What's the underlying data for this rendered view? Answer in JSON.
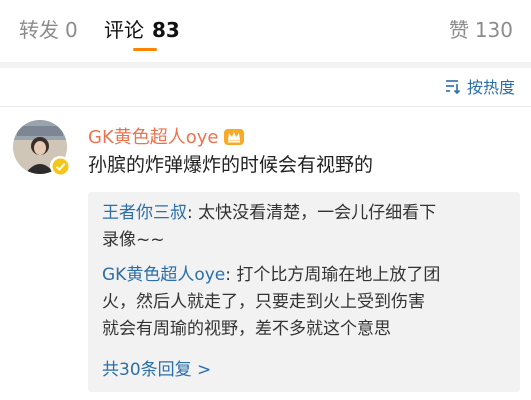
{
  "tabs": {
    "forward_label": "转发",
    "forward_count": "0",
    "comments_label": "评论",
    "comments_count": "83",
    "likes_label": "赞",
    "likes_count": "130"
  },
  "sort": {
    "label": "按热度",
    "icon": "sort-icon"
  },
  "comment": {
    "username": "GK黄色超人oye",
    "text": "孙膑的炸弹爆炸的时候会有视野的",
    "badge_icon": "crown-icon",
    "verified_icon": "verified-badge-icon"
  },
  "replies": [
    {
      "name": "王者你三叔",
      "line1": "太快没看清楚，一会儿仔细看下",
      "line2": "录像~~"
    },
    {
      "name": "GK黄色超人oye",
      "line1": "打个比方周瑜在地上放了团",
      "line2": "火，然后人就走了，只要走到火上受到伤害",
      "line3": "就会有周瑜的视野，差不多就这个意思"
    }
  ],
  "more_replies": "共30条回复 >",
  "colors": {
    "accent": "#ff8200",
    "link": "#2b6ea8",
    "username": "#eb7350"
  }
}
